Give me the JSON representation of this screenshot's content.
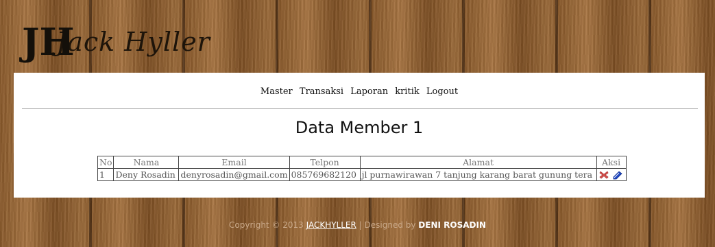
{
  "logo": {
    "mark": "JH",
    "text": "Jack Hyller"
  },
  "nav": {
    "items": [
      "Master",
      "Transaksi",
      "Laporan",
      "kritik",
      "Logout"
    ]
  },
  "page_title": "Data Member 1",
  "table": {
    "headers": [
      "No",
      "Nama",
      "Email",
      "Telpon",
      "Alamat",
      "Aksi"
    ],
    "rows": [
      {
        "no": "1",
        "nama": "Deny Rosadin",
        "email": "denyrosadin@gmail.com",
        "telpon": "085769682120",
        "alamat": "jl purnawirawan 7 tanjung karang barat gunung tera"
      }
    ],
    "actions": [
      "delete-icon",
      "edit-icon"
    ]
  },
  "footer": {
    "prefix": "Copyright © 2013 ",
    "site_link": "JACKHYLLER",
    "separator": " | Designed by ",
    "author": "DENI ROSADIN"
  },
  "colors": {
    "panel_bg": "#ffffff",
    "wood": "#8f5f30",
    "footer_text": "#c9a98a"
  }
}
